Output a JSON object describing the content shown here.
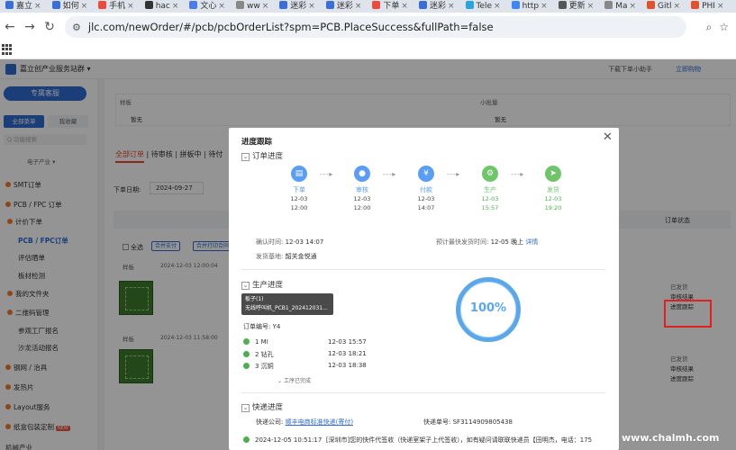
{
  "browser": {
    "tabs": [
      {
        "label": "嘉立",
        "color": "#3b6fd6"
      },
      {
        "label": "如何",
        "color": "#3b6fd6"
      },
      {
        "label": "手机",
        "color": "#e94b3c"
      },
      {
        "label": "hac",
        "color": "#333333"
      },
      {
        "label": "文心",
        "color": "#4b7be5"
      },
      {
        "label": "ww",
        "color": "#888888"
      },
      {
        "label": "迷彩",
        "color": "#3b6fd6"
      },
      {
        "label": "迷彩",
        "color": "#3b6fd6"
      },
      {
        "label": "下单",
        "color": "#e94b3c"
      },
      {
        "label": "迷彩",
        "color": "#3b6fd6"
      },
      {
        "label": "Tele",
        "color": "#2aa3df"
      },
      {
        "label": "http",
        "color": "#4285f4"
      },
      {
        "label": "更新",
        "color": "#555555"
      },
      {
        "label": "Ma",
        "color": "#888888"
      },
      {
        "label": "Gitl",
        "color": "#e0522e"
      },
      {
        "label": "PHI",
        "color": "#e0522e"
      }
    ],
    "url": "jlc.com/newOrder/#/pcb/pcbOrderList?spm=PCB.PlaceSuccess&fullPath=false"
  },
  "header": {
    "brand": "嘉立创产业服务站群 ▾",
    "right1": "下载下单小助手",
    "right2": "立即购物"
  },
  "sidebar": {
    "vip_button": "专属客服",
    "tab_all": "全部菜单",
    "tab_fav": "我收藏",
    "search_placeholder": "Q 功能搜索",
    "category": "电子产业 ▾",
    "items": [
      {
        "label": "SMT订单",
        "sub": false,
        "dot": true
      },
      {
        "label": "PCB / FPC 订单",
        "sub": false,
        "dot": true
      },
      {
        "label": "计价下单",
        "sub": true,
        "dot": true
      },
      {
        "label": "PCB / FPC订单",
        "sub": true,
        "dot": false,
        "active": true
      },
      {
        "label": "评估晒单",
        "sub": true,
        "dot": false
      },
      {
        "label": "板材检测",
        "sub": true,
        "dot": false
      },
      {
        "label": "我的文件夹",
        "sub": true,
        "dot": true
      },
      {
        "label": "二维码管理",
        "sub": true,
        "dot": true
      },
      {
        "label": "参观工厂报名",
        "sub": true,
        "dot": false
      },
      {
        "label": "沙龙活动报名",
        "sub": true,
        "dot": false
      },
      {
        "label": "钢网 / 治具",
        "sub": false,
        "dot": true
      },
      {
        "label": "发热片",
        "sub": false,
        "dot": true
      },
      {
        "label": "Layout服务",
        "sub": false,
        "dot": true
      },
      {
        "label": "纸盒包装定制",
        "sub": false,
        "dot": true,
        "hot": "NEW"
      },
      {
        "label": "机械产业",
        "sub": false,
        "dot": false
      }
    ]
  },
  "main": {
    "sample_col1": "样板",
    "sample_col2": "小批量",
    "sample_val1": "暂无",
    "sample_val2": "暂无",
    "tabs_all": "全部订单",
    "tabs_rest": " | 待审核 | 拼板中 | 待付",
    "order_date_label": "下单日期:",
    "order_date_value": "2024-09-27",
    "status_col": "订单状态",
    "select_all": "全选",
    "btn1": "合并支付",
    "btn2": "合并打印合同",
    "order1_tag": "样板",
    "order1_time": "2024-12-03 12:00:04",
    "order2_tag": "样板",
    "order2_time": "2024-12-03 11:58:00",
    "order1_status": [
      "已发货",
      "审核结果",
      "进度跟踪"
    ],
    "order2_status": [
      "已发货",
      "审核结果",
      "进度跟踪"
    ]
  },
  "modal": {
    "title": "进度跟踪",
    "close": "✕",
    "section_order": "订单进度",
    "steps": [
      {
        "label": "下单",
        "date": "12-03",
        "time": "12:00",
        "icon": "doc-icon",
        "glyph": "▤",
        "green": false
      },
      {
        "label": "审核",
        "date": "12-03",
        "time": "12:00",
        "icon": "user-icon",
        "glyph": "●",
        "green": false
      },
      {
        "label": "付款",
        "date": "12-03",
        "time": "14:07",
        "icon": "money-icon",
        "glyph": "¥",
        "green": false
      },
      {
        "label": "生产",
        "date": "12-03",
        "time": "15:57",
        "icon": "factory-icon",
        "glyph": "⚙",
        "green": true
      },
      {
        "label": "发货",
        "date": "12-03",
        "time": "19:20",
        "icon": "truck-icon",
        "glyph": "➤",
        "green": true
      }
    ],
    "confirm_label": "确认时间:",
    "confirm_value": "12-03 14:07",
    "ship_label": "发货基地:",
    "ship_value": "韶关金悦通",
    "eta_label": "预计最快发货时间:",
    "eta_value": "12-05 晚上",
    "eta_link": "详情",
    "section_prod": "生产进度",
    "tooltip_line1": "板子(1)",
    "tooltip_line2": "无线呼叫机_PCB1_202412031...",
    "order_no": "订单编号: Y4",
    "processes": [
      {
        "name": "1 MI",
        "time": "12-03 15:57"
      },
      {
        "name": "2 钻孔",
        "time": "12-03 18:21"
      },
      {
        "name": "3 沉铜",
        "time": "12-03 18:38"
      }
    ],
    "more_text": "工序已完成",
    "progress_percent": "100%",
    "section_express": "快递进度",
    "express_company_label": "快递公司:",
    "express_company": "顺丰电商标准快递(寄付)",
    "express_no_label": "快递单号:",
    "express_no": "SF3114909805438",
    "express_time": "2024-12-05 10:51:17",
    "express_text": "[深圳市]您的快件代签收（快递室架子上代签收），如有疑问请联联快递员【田明杰，电话：175"
  },
  "watermark": "www.chalmh.com"
}
